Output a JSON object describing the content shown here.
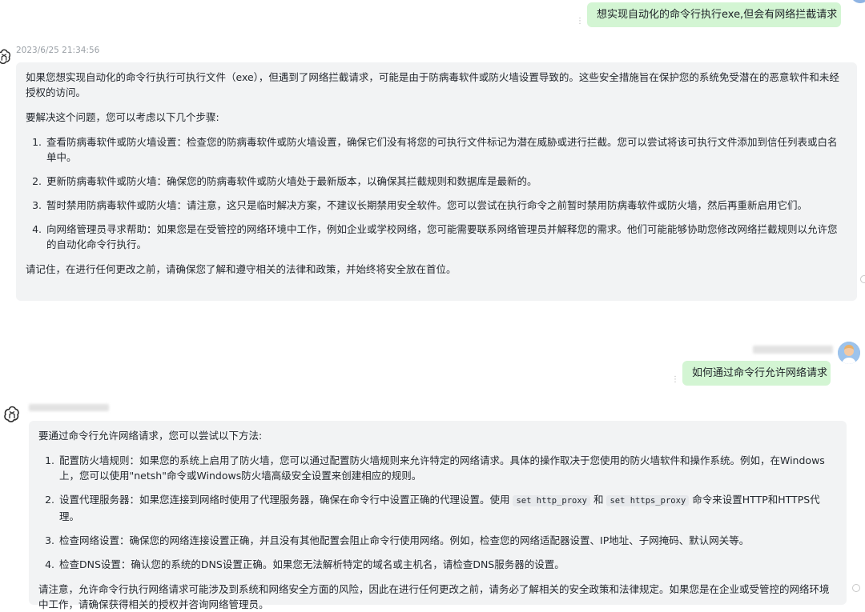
{
  "colors": {
    "user_bubble": "#d3f5d3",
    "ai_bubble": "#f2f3f4",
    "timestamp": "#9aa0a6"
  },
  "conversation": {
    "msg1_user": {
      "text": "想实现自动化的命令行执行exe,但会有网络拦截请求",
      "menu_icon": "more-vertical-icon"
    },
    "msg1_ai": {
      "timestamp": "2023/6/25 21:34:56",
      "avatar_icon": "openai-logo-icon",
      "intro": "如果您想实现自动化的命令行执行可执行文件（exe），但遇到了网络拦截请求，可能是由于防病毒软件或防火墙设置导致的。这些安全措施旨在保护您的系统免受潜在的恶意软件和未经授权的访问。",
      "lead": "要解决这个问题，您可以考虑以下几个步骤:",
      "steps": [
        "查看防病毒软件或防火墙设置：检查您的防病毒软件或防火墙设置，确保它们没有将您的可执行文件标记为潜在威胁或进行拦截。您可以尝试将该可执行文件添加到信任列表或白名单中。",
        "更新防病毒软件或防火墙：确保您的防病毒软件或防火墙处于最新版本，以确保其拦截规则和数据库是最新的。",
        "暂时禁用防病毒软件或防火墙：请注意，这只是临时解决方案，不建议长期禁用安全软件。您可以尝试在执行命令之前暂时禁用防病毒软件或防火墙，然后再重新启用它们。",
        "向网络管理员寻求帮助：如果您是在受管控的网络环境中工作，例如企业或学校网络，您可能需要联系网络管理员并解释您的需求。他们可能能够协助您修改网络拦截规则以允许您的自动化命令行执行。"
      ],
      "closing": "请记住，在进行任何更改之前，请确保您了解和遵守相关的法律和政策，并始终将安全放在首位。"
    },
    "msg2_user": {
      "text": "如何通过命令行允许网络请求",
      "avatar_icon": "user-avatar-icon",
      "menu_icon": "more-vertical-icon"
    },
    "msg2_ai": {
      "avatar_icon": "openai-logo-icon",
      "intro": "要通过命令行允许网络请求，您可以尝试以下方法:",
      "step1": "配置防火墙规则：如果您的系统上启用了防火墙，您可以通过配置防火墙规则来允许特定的网络请求。具体的操作取决于您使用的防火墙软件和操作系统。例如，在Windows上，您可以使用\"netsh\"命令或Windows防火墙高级安全设置来创建相应的规则。",
      "step2_a": "设置代理服务器：如果您连接到网络时使用了代理服务器，确保在命令行中设置正确的代理设置。使用 ",
      "step2_code1": "set http_proxy",
      "step2_b": " 和 ",
      "step2_code2": "set https_proxy",
      "step2_c": " 命令来设置HTTP和HTTPS代理。",
      "step3": "检查网络设置：确保您的网络连接设置正确，并且没有其他配置会阻止命令行使用网络。例如，检查您的网络适配器设置、IP地址、子网掩码、默认网关等。",
      "step4": "检查DNS设置：确认您的系统的DNS设置正确。如果您无法解析特定的域名或主机名，请检查DNS服务器的设置。",
      "closing": "请注意，允许命令行执行网络请求可能涉及到系统和网络安全方面的风险，因此在进行任何更改之前，请务必了解相关的安全政策和法律规定。如果您是在企业或受管控的网络环境中工作，请确保获得相关的授权并咨询网络管理员。"
    }
  }
}
